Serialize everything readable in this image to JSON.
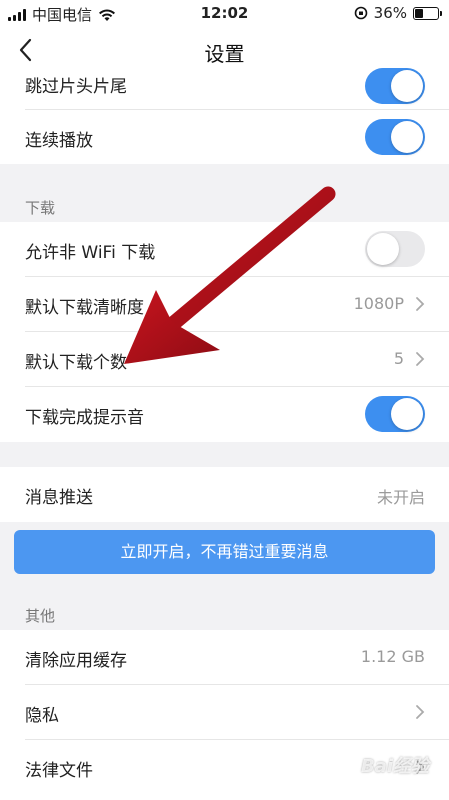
{
  "status_bar": {
    "carrier": "中国电信",
    "time": "12:02",
    "battery_percent": "36%",
    "battery_level": 0.36
  },
  "nav": {
    "title": "设置",
    "back_icon": "chevron-left-icon"
  },
  "playback": {
    "skip_intro_outro": {
      "label": "跳过片头片尾",
      "on": true
    },
    "continuous_play": {
      "label": "连续播放",
      "on": true
    }
  },
  "download": {
    "section_title": "下载",
    "allow_non_wifi": {
      "label": "允许非 WiFi 下载",
      "on": false
    },
    "default_quality": {
      "label": "默认下载清晰度",
      "value": "1080P"
    },
    "default_count": {
      "label": "默认下载个数",
      "value": "5"
    },
    "complete_sound": {
      "label": "下载完成提示音",
      "on": true
    }
  },
  "notifications": {
    "push": {
      "label": "消息推送",
      "value": "未开启"
    },
    "enable_button": "立即开启，不再错过重要消息"
  },
  "other": {
    "section_title": "其他",
    "clear_cache": {
      "label": "清除应用缓存",
      "value": "1.12 GB"
    },
    "privacy": {
      "label": "隐私"
    },
    "legal": {
      "label": "法律文件"
    }
  },
  "watermark": "Bai经验",
  "colors": {
    "accent": "#3d8ff0",
    "button": "#4c97f1",
    "annotation_arrow": "#b0101a"
  }
}
